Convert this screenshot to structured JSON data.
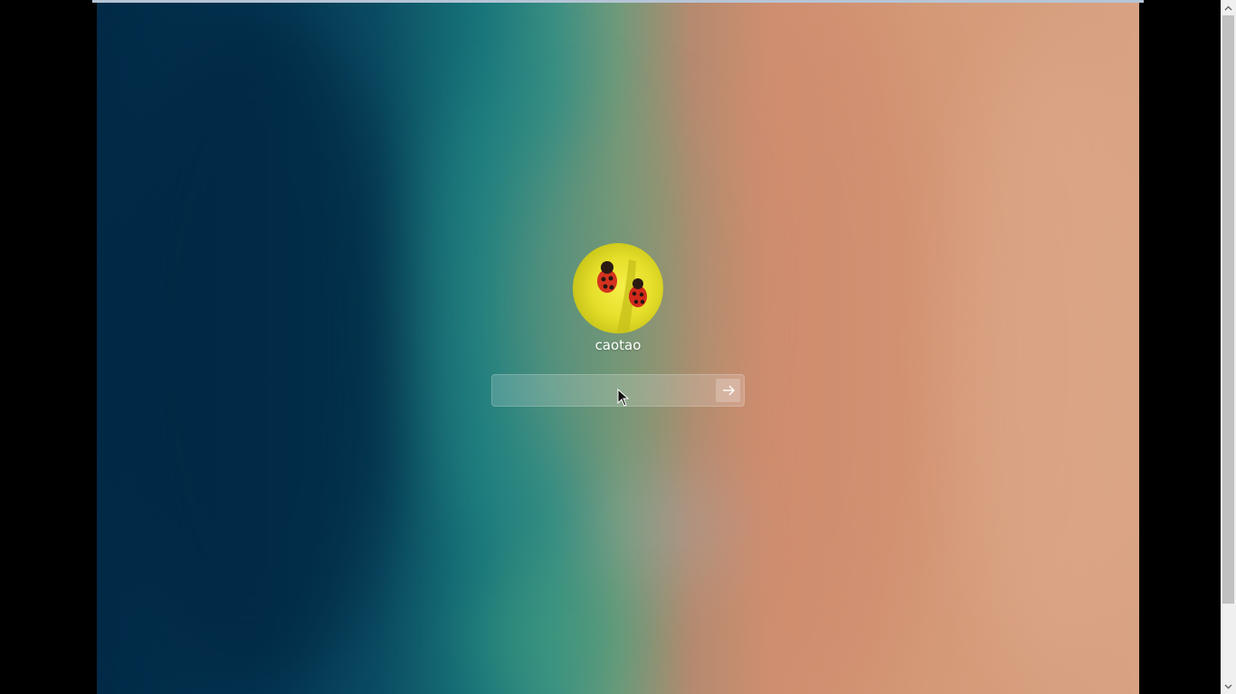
{
  "lock_screen": {
    "username": "caotao",
    "password": {
      "value": "",
      "placeholder": ""
    },
    "submit_icon": "arrow-right-icon",
    "avatar_icon": "ladybug-avatar-icon",
    "colors": {
      "background_left": "#022a47",
      "background_center": "#18757a",
      "background_right": "#d8a283",
      "avatar_yellow": "#e6df2a",
      "text": "#ffffff"
    }
  },
  "scrollbar": {
    "up_icon": "chevron-up-icon",
    "down_icon": "chevron-down-icon"
  }
}
